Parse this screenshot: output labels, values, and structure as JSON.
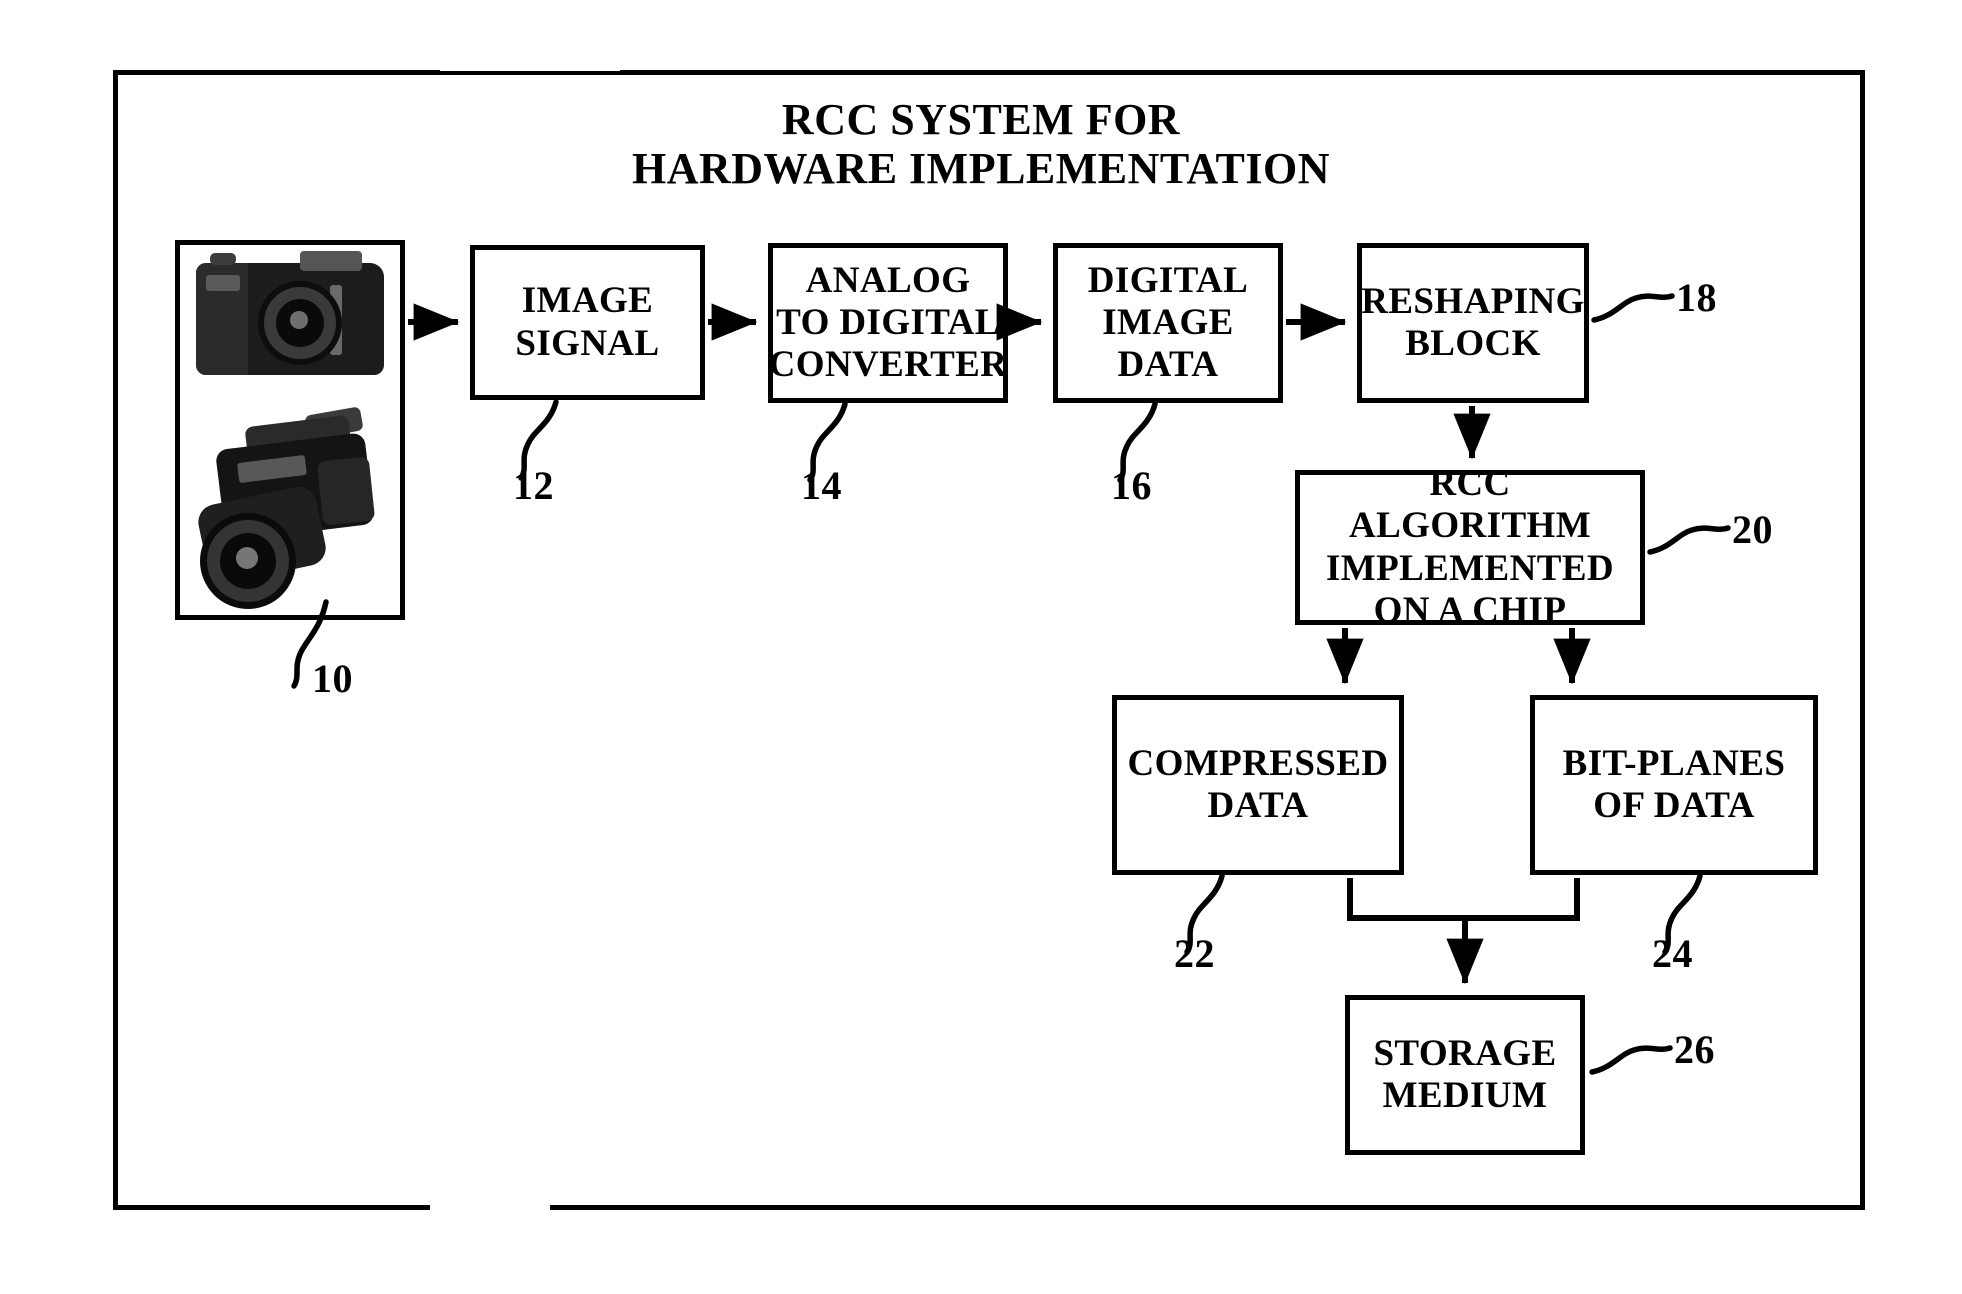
{
  "figure": {
    "title_line1": "RCC SYSTEM FOR",
    "title_line2": "HARDWARE IMPLEMENTATION"
  },
  "boxes": {
    "image_signal": "IMAGE\nSIGNAL",
    "adc": "ANALOG\nTO DIGITAL\nCONVERTER",
    "digital_image_data": "DIGITAL\nIMAGE\nDATA",
    "reshaping_block": "RESHAPING\nBLOCK",
    "rcc_algorithm": "RCC ALGORITHM\nIMPLEMENTED\nON A CHIP",
    "compressed_data": "COMPRESSED\nDATA",
    "bit_planes": "BIT-PLANES\nOF DATA",
    "storage_medium": "STORAGE\nMEDIUM"
  },
  "refs": {
    "camera": "10",
    "image_signal": "12",
    "adc": "14",
    "digital_image_data": "16",
    "reshaping_block": "18",
    "rcc_algorithm": "20",
    "compressed_data": "22",
    "bit_planes": "24",
    "storage_medium": "26"
  },
  "colors": {
    "ink": "#000000",
    "paper": "#ffffff"
  }
}
